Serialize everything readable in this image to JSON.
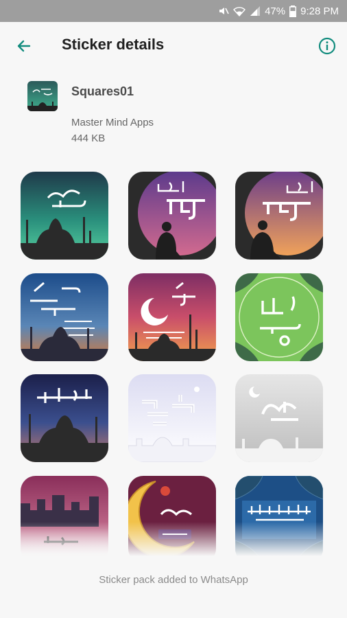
{
  "status_bar": {
    "battery_percent": "47%",
    "time": "9:28 PM",
    "icons": [
      "mute-icon",
      "wifi-icon",
      "signal-icon",
      "battery-icon"
    ]
  },
  "app_bar": {
    "title": "Sticker details",
    "back_icon": "arrow-left-icon",
    "info_icon": "info-icon",
    "accent_color": "#128C7E"
  },
  "pack": {
    "name": "Squares01",
    "publisher": "Master Mind Apps",
    "size": "444 KB"
  },
  "stickers": [
    {
      "theme": "ramadan-kareem-mosque-teal"
    },
    {
      "theme": "dua-moon-purple"
    },
    {
      "theme": "dua-moon-orange"
    },
    {
      "theme": "eid-mubarak-mosque-blue"
    },
    {
      "theme": "eid-mubarak-crescent-sunset"
    },
    {
      "theme": "eid-mubarak-green-ornament"
    },
    {
      "theme": "eid-mubarak-mosque-night"
    },
    {
      "theme": "eid-mubarak-white-city"
    },
    {
      "theme": "eid-mubarak-gray-mosque"
    },
    {
      "theme": "ramadan-city-purple"
    },
    {
      "theme": "ramadan-kareem-golden-crescent"
    },
    {
      "theme": "shahada-blue-ornament"
    }
  ],
  "footer": {
    "message": "Sticker pack added to WhatsApp"
  }
}
